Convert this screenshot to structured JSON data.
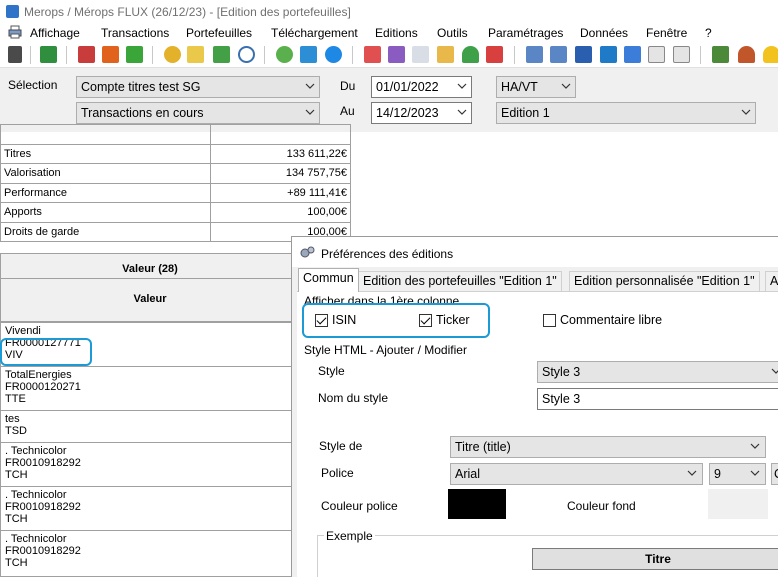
{
  "window": {
    "title": "Merops / Mérops FLUX (26/12/23) - [Edition des portefeuilles]"
  },
  "menu": [
    "Affichage",
    "Transactions",
    "Portefeuilles",
    "Téléchargement",
    "Editions",
    "Outils",
    "Paramétrages",
    "Données",
    "Fenêtre",
    "?"
  ],
  "filters": {
    "selection_label": "Sélection",
    "account": "Compte titres test SG",
    "transactions": "Transactions en cours",
    "du_label": "Du",
    "au_label": "Au",
    "date_from": "01/01/2022",
    "date_to": "14/12/2023",
    "mode": "HA/VT",
    "edition": "Edition 1"
  },
  "summary": [
    {
      "label": "Titres",
      "value": "133 611,22€"
    },
    {
      "label": "Valorisation",
      "value": "134 757,75€"
    },
    {
      "label": "Performance",
      "value": "+89 111,41€"
    },
    {
      "label": "Apports",
      "value": "100,00€"
    },
    {
      "label": "Droits de garde",
      "value": "100,00€"
    }
  ],
  "values_table": {
    "header": "Valeur (28)",
    "subheader": "Valeur",
    "rows": [
      {
        "name": "Vivendi",
        "isin": "FR0000127771",
        "ticker": "VIV"
      },
      {
        "name": "TotalEnergies",
        "isin": "FR0000120271",
        "ticker": "TTE"
      },
      {
        "name": "tes",
        "isin": "",
        "ticker": "TSD"
      },
      {
        "name": ". Technicolor",
        "isin": "FR0010918292",
        "ticker": "TCH"
      },
      {
        "name": ". Technicolor",
        "isin": "FR0010918292",
        "ticker": "TCH"
      },
      {
        "name": ". Technicolor",
        "isin": "FR0010918292",
        "ticker": "TCH"
      }
    ]
  },
  "dialog": {
    "title": "Préférences des éditions",
    "tabs": [
      "Commun",
      "Edition des portefeuilles \"Edition 1\"",
      "Edition personnalisée \"Edition 1\"",
      "A"
    ],
    "first_column_group": "Afficher dans la 1ère colonne",
    "isin_label": "ISIN",
    "isin_checked": true,
    "ticker_label": "Ticker",
    "ticker_checked": true,
    "comment_label": "Commentaire libre",
    "comment_checked": false,
    "style_group": "Style HTML - Ajouter / Modifier",
    "style_label": "Style",
    "style_value": "Style 3",
    "style_name_label": "Nom du style",
    "style_name_value": "Style 3",
    "style_de_label": "Style de",
    "style_de_value": "Titre (title)",
    "police_label": "Police",
    "police_value": "Arial",
    "police_size": "9",
    "police_extra": "C",
    "couleur_police_label": "Couleur police",
    "couleur_police": "#000000",
    "couleur_fond_label": "Couleur fond",
    "couleur_fond": "#f0f0f0",
    "example_label": "Exemple",
    "example_cell": "Titre"
  },
  "colors": {
    "highlight": "#1b9ad6"
  }
}
